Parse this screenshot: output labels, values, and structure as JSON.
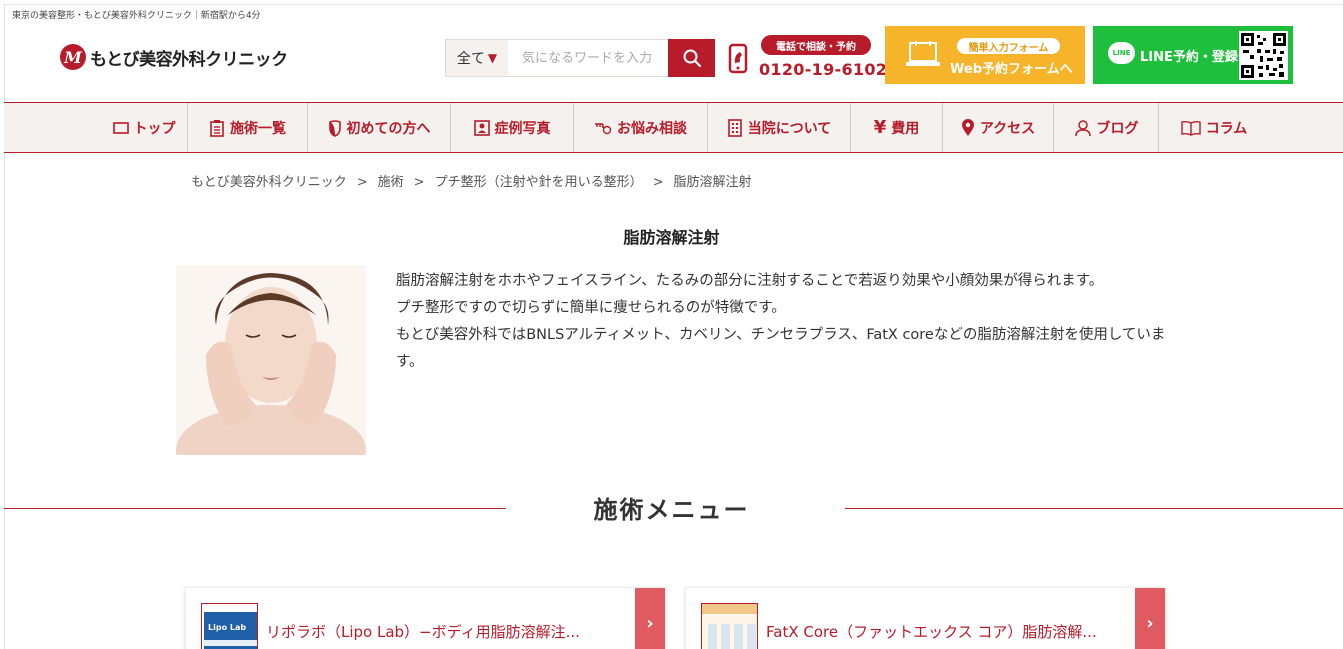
{
  "header": {
    "tagline": "東京の美容整形・もとび美容外科クリニック｜新宿駅から4分",
    "logo_text": "もとび美容外科クリニック",
    "search": {
      "select_value": "全て",
      "placeholder": "気になるワードを入力"
    },
    "phone": {
      "badge": "電話で相談・予約",
      "number": "0120-19-6102"
    },
    "webform": {
      "badge": "簡単入力フォーム",
      "label": "Web予約フォームへ"
    },
    "line": {
      "icon_text": "LINE",
      "label": "LINE予約・登録"
    }
  },
  "nav": {
    "items": [
      {
        "label": "トップ",
        "icon": "square-icon"
      },
      {
        "label": "施術一覧",
        "icon": "clipboard-icon"
      },
      {
        "label": "初めての方へ",
        "icon": "leaf-icon"
      },
      {
        "label": "症例写真",
        "icon": "portrait-icon"
      },
      {
        "label": "お悩み相談",
        "icon": "key-icon"
      },
      {
        "label": "当院について",
        "icon": "building-icon"
      },
      {
        "label": "費用",
        "icon": "yen-icon"
      },
      {
        "label": "アクセス",
        "icon": "map-pin-icon"
      },
      {
        "label": "ブログ",
        "icon": "person-icon"
      },
      {
        "label": "コラム",
        "icon": "book-icon"
      }
    ]
  },
  "breadcrumb": [
    "もとび美容外科クリニック",
    "施術",
    "プチ整形（注射や針を用いる整形）",
    "脂肪溶解注射"
  ],
  "breadcrumb_sep": ">",
  "main": {
    "title": "脂肪溶解注射",
    "intro": [
      "脂肪溶解注射をホホやフェイスライン、たるみの部分に注射することで若返り効果や小顔効果が得られます。",
      "プチ整形ですので切らずに簡単に痩せられるのが特徴です。",
      "もとび美容外科ではBNLSアルティメット、カベリン、チンセラプラス、FatX coreなどの脂肪溶解注射を使用しています。"
    ],
    "menu_heading": "施術メニュー",
    "cards": [
      {
        "title": "リポラボ（Lipo Lab）−ボディ用脂肪溶解注...",
        "thumb_text": "Lipo Lab"
      },
      {
        "title": "FatX Core（ファットエックス コア）脂肪溶解..."
      }
    ]
  },
  "colors": {
    "brand": "#b81c2a",
    "webform": "#f6b42b",
    "line": "#1ebf3c",
    "card_arrow": "#e05a62"
  }
}
